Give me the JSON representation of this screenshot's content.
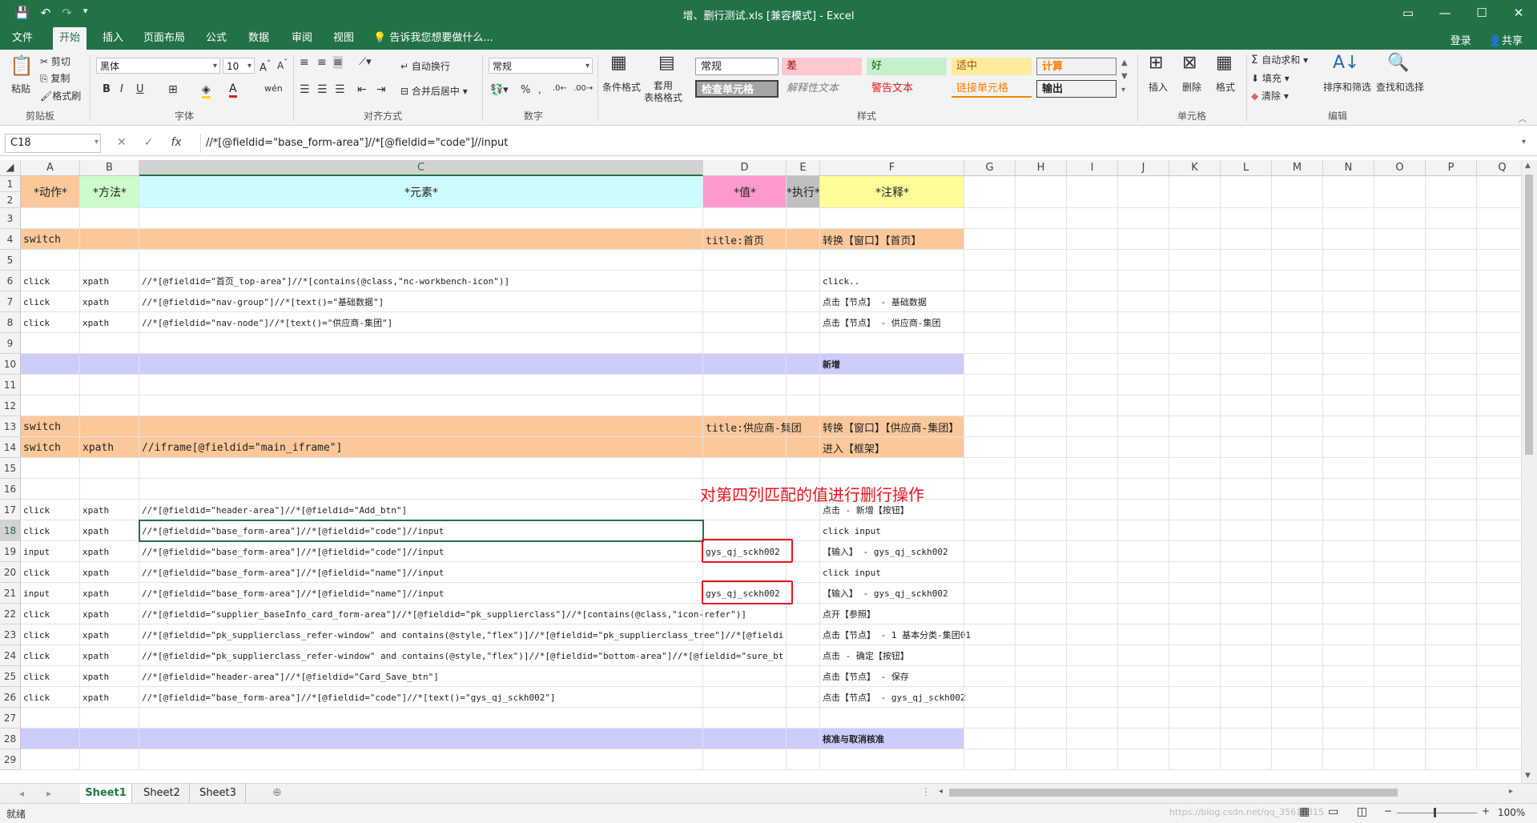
{
  "titlebar": {
    "title": "增、删行测试.xls  [兼容模式] - Excel"
  },
  "menubar": {
    "tabs": [
      "文件",
      "开始",
      "插入",
      "页面布局",
      "公式",
      "数据",
      "审阅",
      "视图"
    ],
    "tell_me": "告诉我您想要做什么...",
    "login": "登录",
    "share": "共享"
  },
  "ribbon": {
    "clipboard": {
      "paste": "粘贴",
      "cut": "剪切",
      "copy": "复制",
      "format_painter": "格式刷",
      "label": "剪贴板"
    },
    "font": {
      "name": "黑体",
      "size": "10",
      "label": "字体",
      "bold": "B",
      "italic": "I",
      "underline": "U"
    },
    "alignment": {
      "wrap": "自动换行",
      "merge": "合并后居中",
      "label": "对齐方式"
    },
    "number": {
      "format": "常规",
      "percent": "%",
      "label": "数字"
    },
    "styles": {
      "conditional": "条件格式",
      "table": "套用\n表格格式",
      "label": "样式",
      "cells": [
        "常规",
        "差",
        "好",
        "适中",
        "计算",
        "检查单元格",
        "解释性文本",
        "警告文本",
        "链接单元格",
        "输出"
      ]
    },
    "cells": {
      "insert": "插入",
      "delete": "删除",
      "format": "格式",
      "label": "单元格"
    },
    "editing": {
      "autosum": "自动求和",
      "fill": "填充",
      "clear": "清除",
      "sort": "排序和筛选",
      "find": "查找和选择",
      "label": "编辑"
    }
  },
  "formula_bar": {
    "name_box": "C18",
    "formula": "//*[@fieldid=\"base_form-area\"]//*[@fieldid=\"code\"]//input"
  },
  "columns": [
    "A",
    "B",
    "C",
    "D",
    "E",
    "F",
    "G",
    "H",
    "I",
    "J",
    "K",
    "L",
    "M",
    "N",
    "O",
    "P",
    "Q"
  ],
  "header_row": {
    "a": "*动作*",
    "b": "*方法*",
    "c": "*元素*",
    "d": "*值*",
    "e": "*执行*",
    "f": "*注释*"
  },
  "rows": [
    {
      "n": "3",
      "a": "",
      "b": "",
      "c": "",
      "d": "",
      "f": ""
    },
    {
      "n": "4",
      "a": "switch",
      "b": "",
      "c": "",
      "d": "title:首页",
      "f": "转换【窗口】【首页】"
    },
    {
      "n": "5",
      "a": "",
      "b": "",
      "c": "",
      "d": "",
      "f": ""
    },
    {
      "n": "6",
      "a": "click",
      "b": "xpath",
      "c": "//*[@fieldid=\"首页_top-area\"]//*[contains(@class,\"nc-workbench-icon\")]",
      "d": "",
      "f": "click.."
    },
    {
      "n": "7",
      "a": "click",
      "b": "xpath",
      "c": "//*[@fieldid=\"nav-group\"]//*[text()=\"基础数据\"]",
      "d": "",
      "f": "点击【节点】 - 基础数据"
    },
    {
      "n": "8",
      "a": "click",
      "b": "xpath",
      "c": "//*[@fieldid=\"nav-node\"]//*[text()=\"供应商-集团\"]",
      "d": "",
      "f": "点击【节点】 - 供应商-集团"
    },
    {
      "n": "9",
      "a": "",
      "b": "",
      "c": "",
      "d": "",
      "f": ""
    },
    {
      "n": "10",
      "a": "",
      "b": "",
      "c": "",
      "d": "",
      "f": "新增"
    },
    {
      "n": "11",
      "a": "",
      "b": "",
      "c": "",
      "d": "",
      "f": ""
    },
    {
      "n": "12",
      "a": "",
      "b": "",
      "c": "",
      "d": "",
      "f": ""
    },
    {
      "n": "13",
      "a": "switch",
      "b": "",
      "c": "",
      "d": "title:供应商-集团",
      "f": "转换【窗口】【供应商-集团】"
    },
    {
      "n": "14",
      "a": "switch",
      "b": "xpath",
      "c": "//iframe[@fieldid=\"main_iframe\"]",
      "d": "",
      "f": "进入【框架】"
    },
    {
      "n": "15",
      "a": "",
      "b": "",
      "c": "",
      "d": "",
      "f": ""
    },
    {
      "n": "16",
      "a": "",
      "b": "",
      "c": "",
      "d": "",
      "f": ""
    },
    {
      "n": "17",
      "a": "click",
      "b": "xpath",
      "c": "//*[@fieldid=\"header-area\"]//*[@fieldid=\"Add_btn\"]",
      "d": "",
      "f": "点击 - 新增【按钮】"
    },
    {
      "n": "18",
      "a": "click",
      "b": "xpath",
      "c": "//*[@fieldid=\"base_form-area\"]//*[@fieldid=\"code\"]//input",
      "d": "",
      "f": "click input"
    },
    {
      "n": "19",
      "a": "input",
      "b": "xpath",
      "c": "//*[@fieldid=\"base_form-area\"]//*[@fieldid=\"code\"]//input",
      "d": "gys_qj_sckh002",
      "f": "【输入】 - gys_qj_sckh002"
    },
    {
      "n": "20",
      "a": "click",
      "b": "xpath",
      "c": "//*[@fieldid=\"base_form-area\"]//*[@fieldid=\"name\"]//input",
      "d": "",
      "f": "click input"
    },
    {
      "n": "21",
      "a": "input",
      "b": "xpath",
      "c": "//*[@fieldid=\"base_form-area\"]//*[@fieldid=\"name\"]//input",
      "d": "gys_qj_sckh002",
      "f": "【输入】 - gys_qj_sckh002"
    },
    {
      "n": "22",
      "a": "click",
      "b": "xpath",
      "c": "//*[@fieldid=\"supplier_baseInfo_card_form-area\"]//*[@fieldid=\"pk_supplierclass\"]//*[contains(@class,\"icon-refer\")]",
      "d": "",
      "f": "点开【参照】"
    },
    {
      "n": "23",
      "a": "click",
      "b": "xpath",
      "c": "//*[@fieldid=\"pk_supplierclass_refer-window\" and contains(@style,\"flex\")]//*[@fieldid=\"pk_supplierclass_tree\"]//*[@fieldi",
      "d": "",
      "f": "点击【节点】 - 1 基本分类-集团01"
    },
    {
      "n": "24",
      "a": "click",
      "b": "xpath",
      "c": "//*[@fieldid=\"pk_supplierclass_refer-window\" and contains(@style,\"flex\")]//*[@fieldid=\"bottom-area\"]//*[@fieldid=\"sure_bt",
      "d": "",
      "f": "点击 - 确定【按钮】"
    },
    {
      "n": "25",
      "a": "click",
      "b": "xpath",
      "c": "//*[@fieldid=\"header-area\"]//*[@fieldid=\"Card_Save_btn\"]",
      "d": "",
      "f": "点击【节点】 - 保存"
    },
    {
      "n": "26",
      "a": "click",
      "b": "xpath",
      "c": "//*[@fieldid=\"base_form-area\"]//*[@fieldid=\"code\"]//*[text()=\"gys_qj_sckh002\"]",
      "d": "",
      "f": "点击【节点】 - gys_qj_sckh002"
    },
    {
      "n": "27",
      "a": "",
      "b": "",
      "c": "",
      "d": "",
      "f": ""
    },
    {
      "n": "28",
      "a": "",
      "b": "",
      "c": "",
      "d": "",
      "f": "核准与取消核准"
    },
    {
      "n": "29",
      "a": "",
      "b": "",
      "c": "",
      "d": "",
      "f": ""
    }
  ],
  "annotation": "对第四列匹配的值进行删行操作",
  "sheets": [
    "Sheet1",
    "Sheet2",
    "Sheet3"
  ],
  "status": {
    "ready": "就绪",
    "zoom": "100%",
    "watermark": "https://blog.csdn.net/qq_35616815"
  },
  "colors": {
    "excel_green": "#217346",
    "orange": "#fcc89b",
    "lavender": "#ccccfc",
    "yellow": "#fefe99",
    "pink": "#fe99cc",
    "lightgreen": "#ccfccc",
    "cyan": "#ccfdfc",
    "gray": "#c0c0c0",
    "red": "#e8141e"
  }
}
